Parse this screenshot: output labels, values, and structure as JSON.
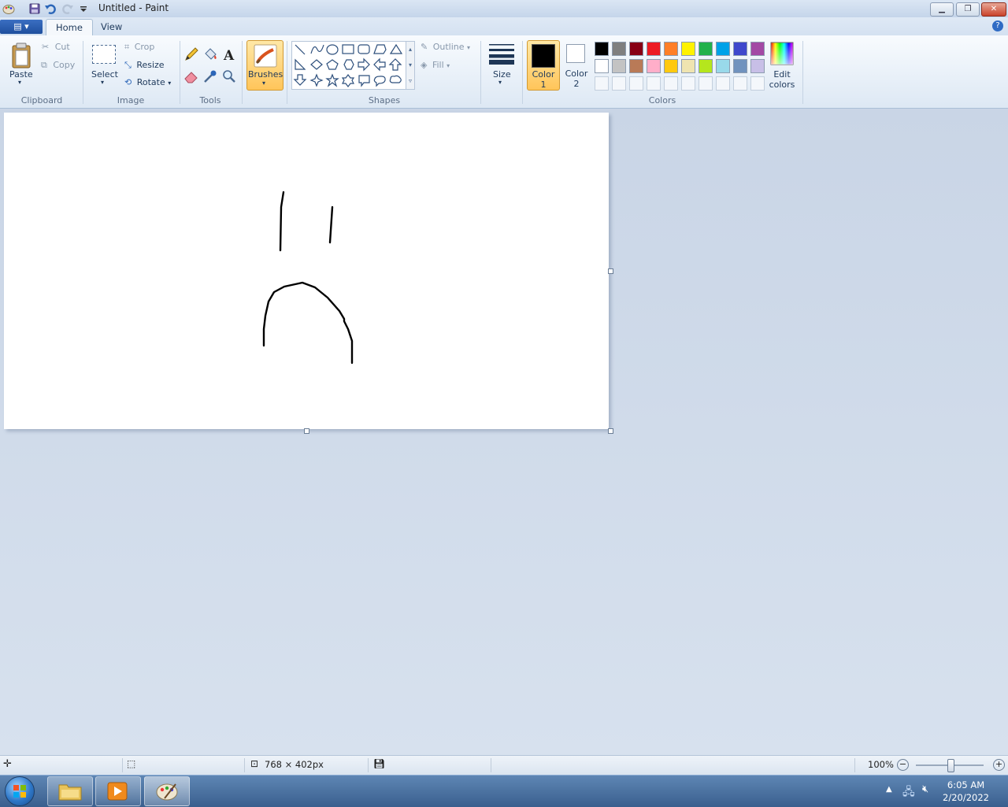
{
  "window": {
    "title": "Untitled - Paint"
  },
  "tabs": [
    {
      "label": "Home"
    },
    {
      "label": "View"
    }
  ],
  "clipboard": {
    "paste": "Paste",
    "cut": "Cut",
    "copy": "Copy",
    "group": "Clipboard"
  },
  "image": {
    "select": "Select",
    "crop": "Crop",
    "resize": "Resize",
    "rotate": "Rotate",
    "group": "Image"
  },
  "tools": {
    "group": "Tools"
  },
  "brushes": {
    "label": "Brushes"
  },
  "shapes": {
    "outline": "Outline",
    "fill": "Fill",
    "group": "Shapes"
  },
  "size": {
    "label": "Size"
  },
  "colors": {
    "color1": "Color 1",
    "color2": "Color 2",
    "edit": "Edit colors",
    "group": "Colors",
    "color1_value": "#000000",
    "color2_value": "#ffffff",
    "palette_row1": [
      "#000000",
      "#7f7f7f",
      "#880015",
      "#ed1c24",
      "#ff7f27",
      "#fff200",
      "#22b14c",
      "#00a2e8",
      "#3f48cc",
      "#a349a4"
    ],
    "palette_row2": [
      "#ffffff",
      "#c3c3c3",
      "#b97a57",
      "#ffaec9",
      "#ffc90e",
      "#efe4b0",
      "#b5e61d",
      "#99d9ea",
      "#7092be",
      "#c8bfe7"
    ]
  },
  "status": {
    "dimensions": "768 × 402px",
    "zoom": "100%"
  },
  "taskbar": {
    "time": "6:05 AM",
    "date": "2/20/2022"
  }
}
